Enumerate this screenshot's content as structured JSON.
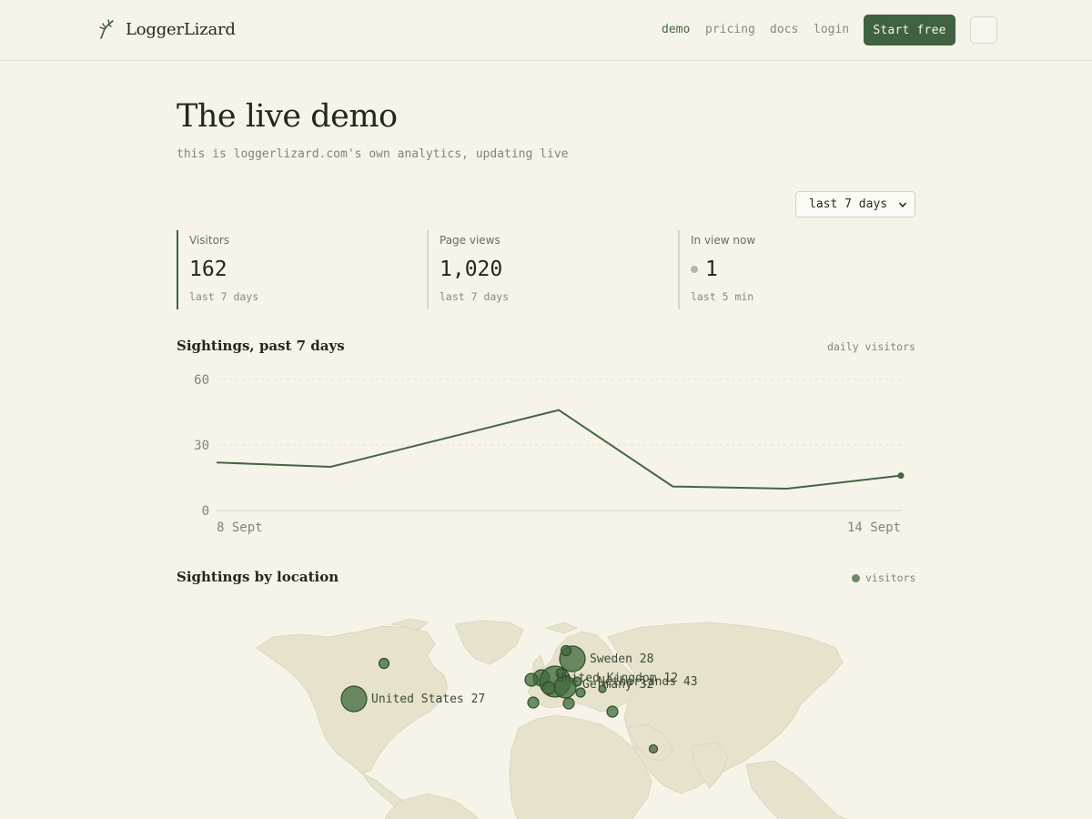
{
  "header": {
    "brand": "LoggerLizard",
    "nav": [
      {
        "label": "demo",
        "active": true
      },
      {
        "label": "pricing",
        "active": false
      },
      {
        "label": "docs",
        "active": false
      },
      {
        "label": "login",
        "active": false
      }
    ],
    "cta_label": "Start free",
    "theme_icon": "moon-icon"
  },
  "page": {
    "title": "The live demo",
    "subtitle": "this is loggerlizard.com's own analytics, updating live",
    "range_selected": "last 7 days"
  },
  "stats": [
    {
      "label": "Visitors",
      "value": "162",
      "sub": "last 7 days"
    },
    {
      "label": "Page views",
      "value": "1,020",
      "sub": "last 7 days"
    },
    {
      "label": "In view now",
      "value": "1",
      "sub": "last 5 min"
    }
  ],
  "sightings": {
    "title": "Sightings, past 7 days",
    "note": "daily visitors"
  },
  "location": {
    "title": "Sightings by location",
    "legend": "visitors"
  },
  "colors": {
    "accent": "#3f6240",
    "line": "#44663f",
    "bubble": "#3f6a3c",
    "land": "#e7e2cc",
    "background": "#f6f3e9"
  },
  "chart_data": {
    "type": "line",
    "title": "Sightings, past 7 days",
    "x_tick_labels": [
      "8 Sept",
      "14 Sept"
    ],
    "x": [
      "8 Sept",
      "9 Sept",
      "10 Sept",
      "11 Sept",
      "12 Sept",
      "13 Sept",
      "14 Sept"
    ],
    "series": [
      {
        "name": "daily visitors",
        "values": [
          22,
          20,
          33,
          46,
          11,
          10,
          16
        ]
      }
    ],
    "y_ticks": [
      0,
      30,
      60
    ],
    "ylim": [
      0,
      60
    ],
    "grid": true
  },
  "map_data": {
    "labels": [
      {
        "text": "Sweden 28"
      },
      {
        "text": "United Kingdom 12"
      },
      {
        "text": "Netherlands 43"
      },
      {
        "text": "Germany 32"
      },
      {
        "text": "United States 27"
      }
    ]
  }
}
